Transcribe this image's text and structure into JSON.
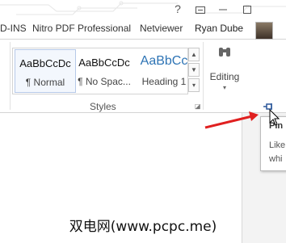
{
  "titlebar": {
    "help_symbol": "?",
    "controls": [
      "restore",
      "minimize",
      "maximize"
    ]
  },
  "tabs": [
    {
      "label": "D-INS"
    },
    {
      "label": "Nitro PDF Professional"
    },
    {
      "label": "Netviewer"
    }
  ],
  "user": {
    "name": "Ryan Dube"
  },
  "ribbon": {
    "styles": [
      {
        "sample": "AaBbCcDc",
        "name": "¶ Normal",
        "selected": true
      },
      {
        "sample": "AaBbCcDc",
        "name": "¶ No Spac...",
        "selected": false
      },
      {
        "sample": "AaBbCc",
        "name": "Heading 1",
        "selected": false
      }
    ],
    "styles_group_label": "Styles",
    "editing_label": "Editing"
  },
  "tooltip": {
    "title": "Pin",
    "body_line1": "Like",
    "body_line2": "whi"
  },
  "watermark": "双电网(www.pcpc.me)",
  "colors": {
    "accent": "#2b579a",
    "heading_style": "#2e74b5",
    "annotation_arrow": "#e02020"
  }
}
